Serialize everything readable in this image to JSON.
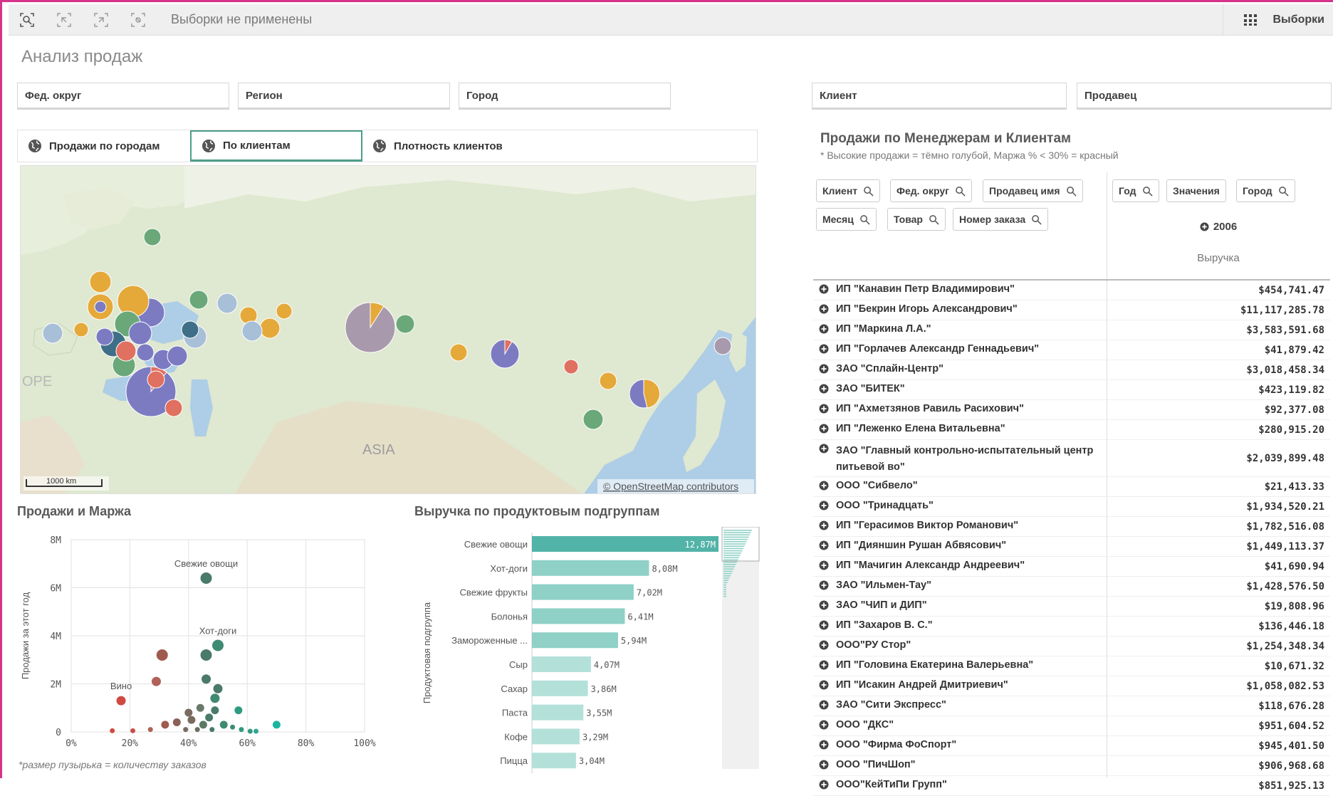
{
  "toolbar": {
    "status": "Выборки не применены",
    "selections_label": "Выборки"
  },
  "page": {
    "title": "Анализ продаж"
  },
  "filters": [
    "Фед. округ",
    "Регион",
    "Город",
    "Клиент",
    "Продавец"
  ],
  "map_tabs": [
    "Продажи по городам",
    "По клиентам",
    "Плотность клиентов"
  ],
  "map": {
    "label_europe": "OPE",
    "label_asia": "ASIA",
    "scale": "1000 km",
    "attribution": "© OpenStreetMap contributors"
  },
  "scatter": {
    "title": "Продажи и Маржа",
    "ylabel": "Продажи за этот год",
    "xlabel": "Маржа %",
    "note": "*размер пузырька = количеству заказов"
  },
  "bars": {
    "title": "Выручка по продуктовым подгруппам",
    "ylabel": "Продуктовая подгруппа"
  },
  "table": {
    "title": "Продажи по Менеджерам и Клиентам",
    "subtitle": "* Высокие продажи = тёмно голубой, Маржа % < 30% = красный",
    "row_dims": [
      "Клиент",
      "Фед. округ",
      "Продавец имя",
      "Месяц",
      "Товар",
      "Номер заказа"
    ],
    "col_dims": [
      "Год",
      "Значения",
      "Город"
    ],
    "year": "2006",
    "measure": "Выручка",
    "rows": [
      {
        "name": "ИП \"Канавин Петр Владимирович\"",
        "value": "$454,741.47"
      },
      {
        "name": "ИП \"Бекрин Игорь Александрович\"",
        "value": "$11,117,285.78"
      },
      {
        "name": "ИП \"Маркина Л.А.\"",
        "value": "$3,583,591.68"
      },
      {
        "name": "ИП \"Горлачев Александр Геннадьевич\"",
        "value": "$41,879.42"
      },
      {
        "name": "ЗАО \"Сплайн-Центр\"",
        "value": "$3,018,458.34"
      },
      {
        "name": "ЗАО \"БИТЕК\"",
        "value": "$423,119.82"
      },
      {
        "name": "ИП \"Ахметзянов Равиль Расихович\"",
        "value": "$92,377.08"
      },
      {
        "name": "ИП \"Леженко Елена Витальевна\"",
        "value": "$280,915.20"
      },
      {
        "name": "ЗАО \"Главный контрольно-испытательный центр питьевой во\"",
        "value": "$2,039,899.48"
      },
      {
        "name": "ООО \"Сибвело\"",
        "value": "$21,413.33"
      },
      {
        "name": "ООО \"Тринадцать\"",
        "value": "$1,934,520.21"
      },
      {
        "name": "ИП \"Герасимов Виктор Романович\"",
        "value": "$1,782,516.08"
      },
      {
        "name": "ИП \"Дияншин Рушан Абвясович\"",
        "value": "$1,449,113.37"
      },
      {
        "name": "ИП \"Мачигин Александр Андреевич\"",
        "value": "$41,690.94"
      },
      {
        "name": "ЗАО \"Ильмен-Тау\"",
        "value": "$1,428,576.50"
      },
      {
        "name": "ЗАО \"ЧИП и ДИП\"",
        "value": "$19,808.96"
      },
      {
        "name": "ИП \"Захаров В. С.\"",
        "value": "$136,446.18"
      },
      {
        "name": "ООО\"РУ Стор\"",
        "value": "$1,254,348.34"
      },
      {
        "name": "ИП \"Головина Екатерина Валерьевна\"",
        "value": "$10,671.32"
      },
      {
        "name": "ИП \"Исакин Андрей Дмитриевич\"",
        "value": "$1,058,082.53"
      },
      {
        "name": "ЗАО \"Сити Экспресс\"",
        "value": "$118,676.28"
      },
      {
        "name": "ООО \"ДКС\"",
        "value": "$951,604.52"
      },
      {
        "name": "ООО \"Фирма ФоСпорт\"",
        "value": "$945,401.50"
      },
      {
        "name": "ООО \"ПичШоп\"",
        "value": "$906,968.68"
      },
      {
        "name": "ООО\"КейТиПи Групп\"",
        "value": "$851,925.13"
      }
    ]
  },
  "chart_data": [
    {
      "type": "scatter",
      "title": "Продажи и Маржа",
      "xlabel": "Маржа %",
      "ylabel": "Продажи за этот год",
      "x_ticks": [
        "0%",
        "20%",
        "40%",
        "60%",
        "80%",
        "100%"
      ],
      "y_ticks": [
        "8M",
        "6M",
        "4M",
        "2M",
        "0"
      ],
      "xlim": [
        0,
        100
      ],
      "ylim": [
        0,
        8000000
      ],
      "grid": true,
      "labeled_points": [
        {
          "label": "Свежие овощи",
          "x": 46,
          "y": 6400000
        },
        {
          "label": "Хот-доги",
          "x": 50,
          "y": 3600000
        },
        {
          "label": "Вино",
          "x": 17,
          "y": 1300000
        }
      ],
      "points": [
        {
          "x": 46,
          "y": 6400000,
          "color": "#4a7a68"
        },
        {
          "x": 31,
          "y": 3200000,
          "color": "#a05a50"
        },
        {
          "x": 46,
          "y": 3200000,
          "color": "#4a7a68"
        },
        {
          "x": 50,
          "y": 3600000,
          "color": "#3f8a72"
        },
        {
          "x": 46,
          "y": 2200000,
          "color": "#4a7a68"
        },
        {
          "x": 29,
          "y": 2100000,
          "color": "#b06258"
        },
        {
          "x": 17,
          "y": 1300000,
          "color": "#d04a40"
        },
        {
          "x": 50,
          "y": 1800000,
          "color": "#4a7a68"
        },
        {
          "x": 49,
          "y": 1400000,
          "color": "#3f8a72"
        },
        {
          "x": 57,
          "y": 900000,
          "color": "#2f9a80"
        },
        {
          "x": 44,
          "y": 1000000,
          "color": "#6a7a6a"
        },
        {
          "x": 40,
          "y": 800000,
          "color": "#7a6a60"
        },
        {
          "x": 49,
          "y": 900000,
          "color": "#4a7a68"
        },
        {
          "x": 47,
          "y": 600000,
          "color": "#4a7a68"
        },
        {
          "x": 41,
          "y": 500000,
          "color": "#7a6a60"
        },
        {
          "x": 36,
          "y": 400000,
          "color": "#8a6058"
        },
        {
          "x": 32,
          "y": 300000,
          "color": "#a05a50"
        },
        {
          "x": 45,
          "y": 300000,
          "color": "#5a7a66"
        },
        {
          "x": 52,
          "y": 300000,
          "color": "#3f8a72"
        },
        {
          "x": 55,
          "y": 200000,
          "color": "#3f8a72"
        },
        {
          "x": 58,
          "y": 100000,
          "color": "#2f9a80"
        },
        {
          "x": 39,
          "y": 100000,
          "color": "#7a6a60"
        },
        {
          "x": 43,
          "y": 100000,
          "color": "#6a7060"
        },
        {
          "x": 48,
          "y": 100000,
          "color": "#4a7a68"
        },
        {
          "x": 27,
          "y": 100000,
          "color": "#b06258"
        },
        {
          "x": 14,
          "y": 50000,
          "color": "#d04a40"
        },
        {
          "x": 21,
          "y": 50000,
          "color": "#c85048"
        },
        {
          "x": 61,
          "y": 30000,
          "color": "#2f9a80"
        },
        {
          "x": 63,
          "y": 30000,
          "color": "#2fa890"
        },
        {
          "x": 70,
          "y": 300000,
          "color": "#1ab5a0"
        }
      ]
    },
    {
      "type": "bar",
      "orientation": "horizontal",
      "title": "Выручка по продуктовым подгруппам",
      "ylabel": "Продуктовая подгруппа",
      "categories": [
        "Свежие овощи",
        "Хот-доги",
        "Свежие фрукты",
        "Болонья",
        "Замороженные ...",
        "Сыр",
        "Сахар",
        "Паста",
        "Кофе",
        "Пицца"
      ],
      "values": [
        12.87,
        8.08,
        7.02,
        6.41,
        5.94,
        4.07,
        3.86,
        3.55,
        3.29,
        3.04
      ],
      "value_labels": [
        "12,87M",
        "8,08M",
        "7,02M",
        "6,41M",
        "5,94M",
        "4,07M",
        "3,86M",
        "3,55M",
        "3,29M",
        "3,04M"
      ],
      "units": "M"
    }
  ]
}
